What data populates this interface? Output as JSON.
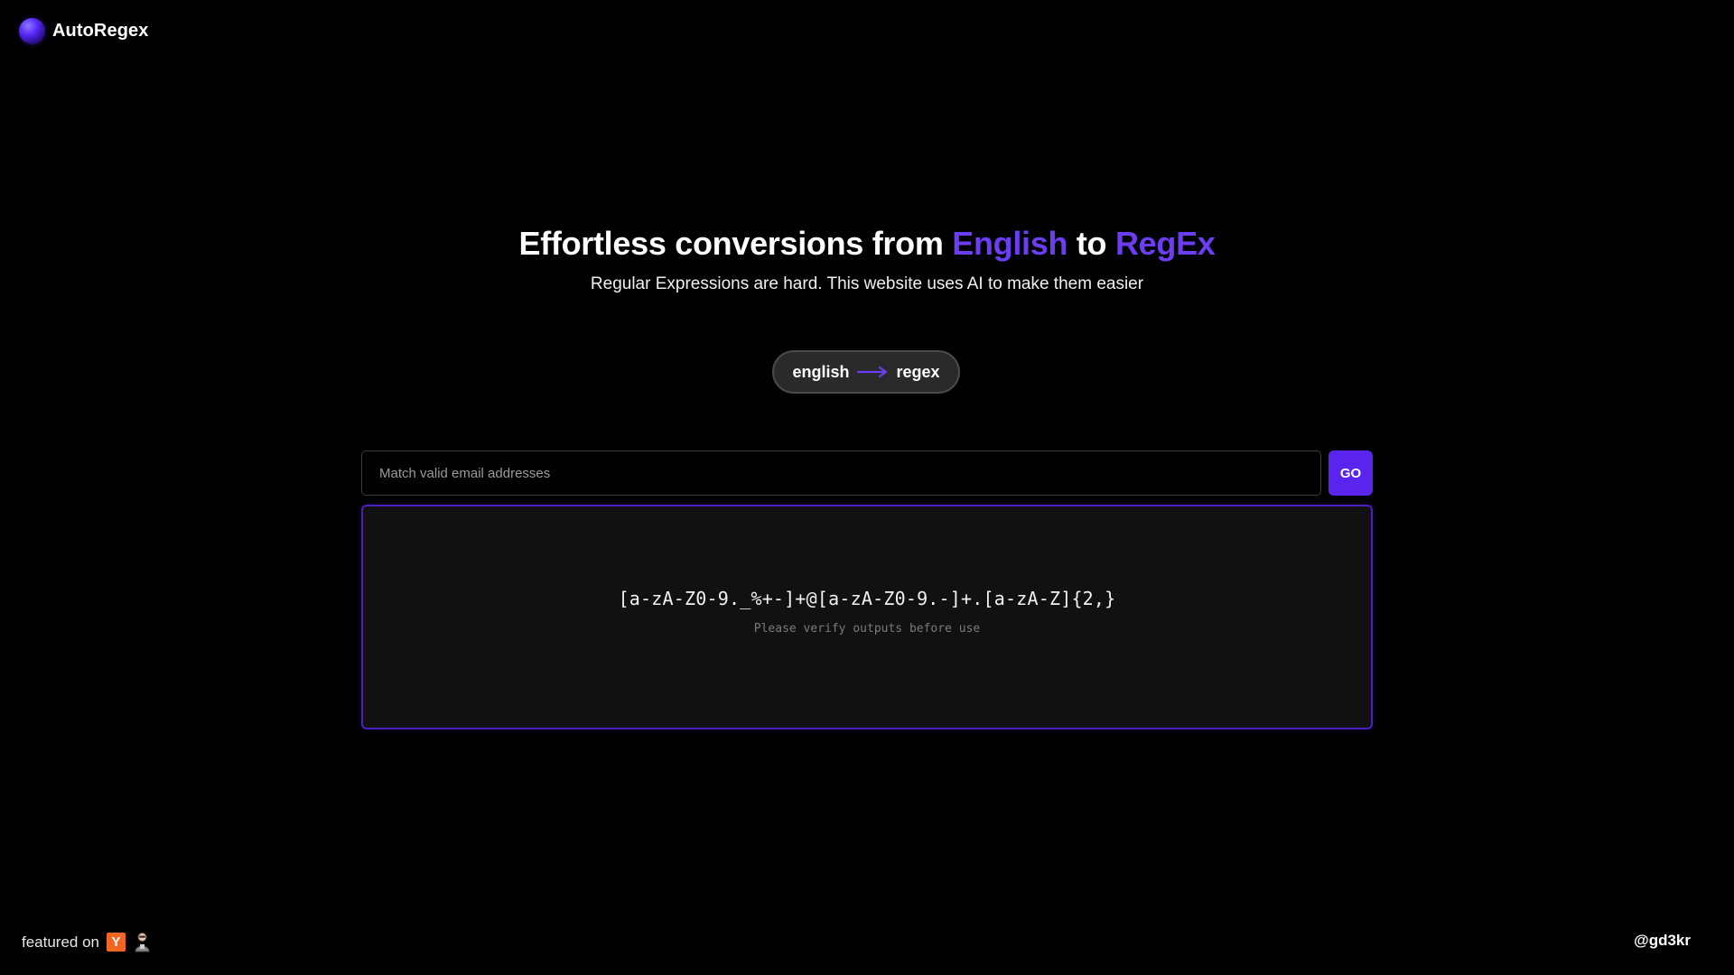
{
  "header": {
    "app_name": "AutoRegex",
    "logo_icon": "purple-orb-icon"
  },
  "hero": {
    "title_prefix": "Effortless conversions from ",
    "title_accent_1": "English",
    "title_middle": " to ",
    "title_accent_2": "RegEx",
    "subtitle": "Regular Expressions are hard. This website uses AI to make them easier"
  },
  "mode_toggle": {
    "from_label": "english",
    "to_label": "regex",
    "arrow_icon": "arrow-right-icon"
  },
  "query": {
    "placeholder": "Match valid email addresses",
    "value": "",
    "go_label": "GO"
  },
  "output": {
    "regex": "[a-zA-Z0-9._%+-]+@[a-zA-Z0-9.-]+.[a-zA-Z]{2,}",
    "note": "Please verify outputs before use"
  },
  "footer": {
    "featured_label": "featured on",
    "featured_icons": [
      "y-combinator-icon",
      "robot-icon"
    ],
    "yc_letter": "Y",
    "handle": "@gd3kr"
  },
  "colors": {
    "background": "#000000",
    "accent": "#6d3df5",
    "button": "#5a23ee",
    "panel_border": "#4a1fc0"
  }
}
